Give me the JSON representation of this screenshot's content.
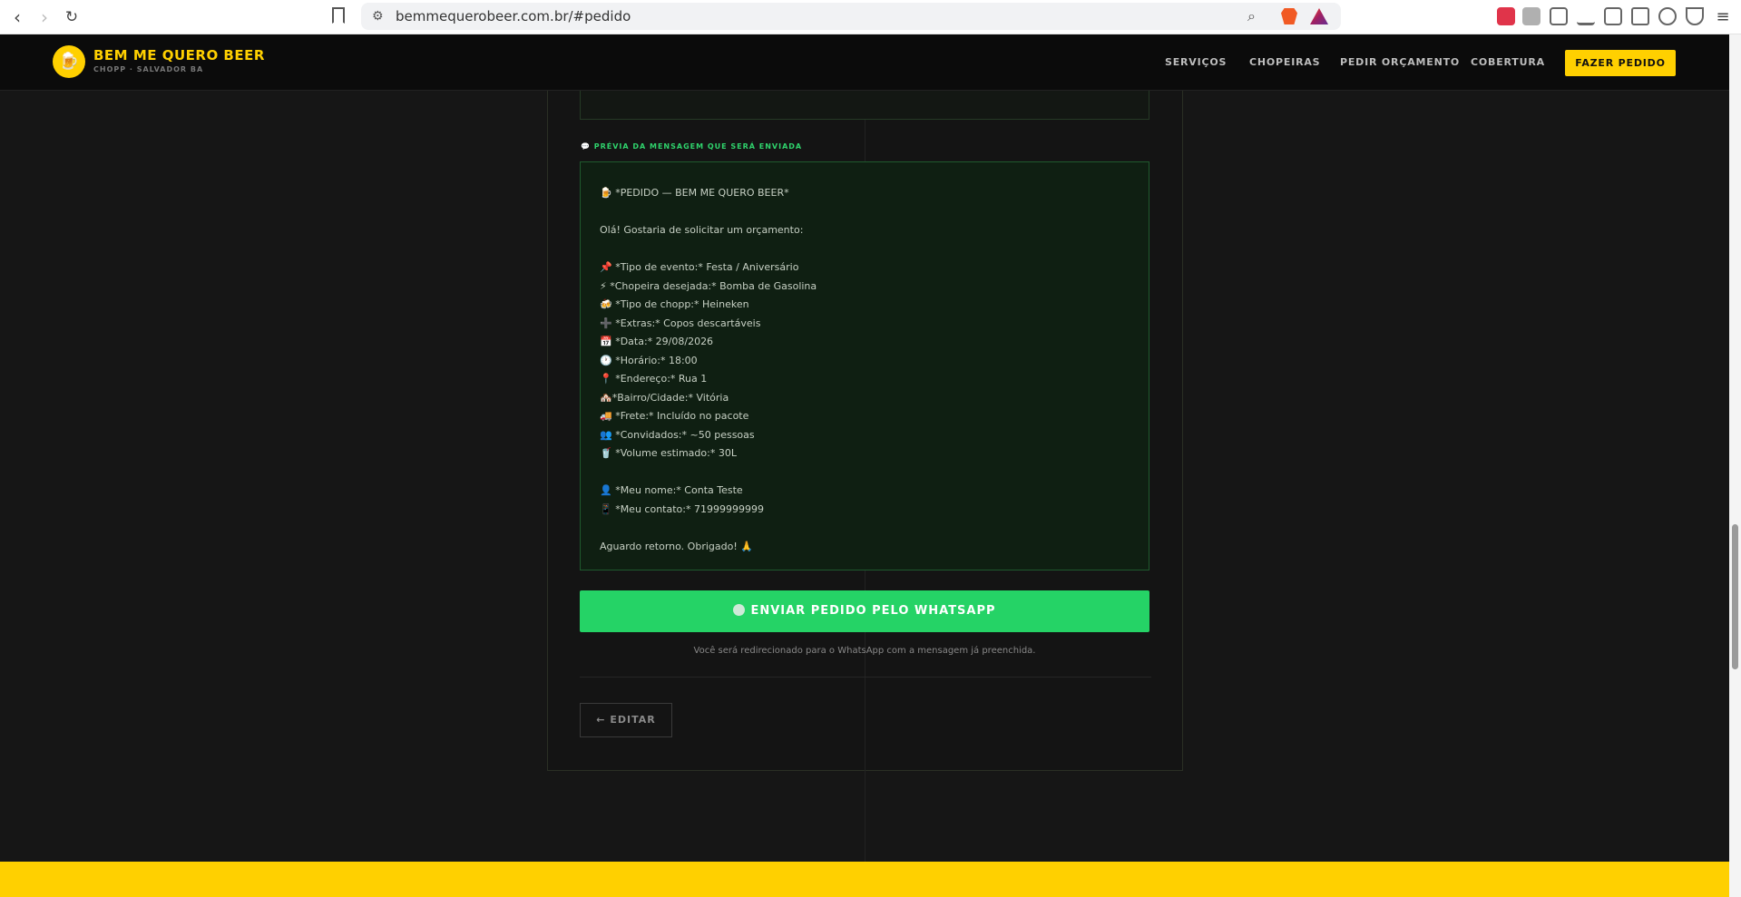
{
  "browser": {
    "url": "bemmequerobeer.com.br/#pedido"
  },
  "header": {
    "brand_name": "BEM ME QUERO BEER",
    "brand_sub": "CHOPP · SALVADOR BA",
    "nav": [
      "SERVIÇOS",
      "CHOPEIRAS",
      "PEDIR ORÇAMENTO",
      "COBERTURA"
    ],
    "cta_label": "FAZER PEDIDO"
  },
  "preview": {
    "label": "💬 PRÉVIA DA MENSAGEM QUE SERÁ ENVIADA",
    "lines": [
      "🍺 *PEDIDO — BEM ME QUERO BEER*",
      "",
      "Olá! Gostaria de solicitar um orçamento:",
      "",
      "📌 *Tipo de evento:* Festa / Aniversário",
      "⚡ *Chopeira desejada:* Bomba de Gasolina",
      "🍻 *Tipo de chopp:* Heineken",
      "➕ *Extras:* Copos descartáveis",
      "📅 *Data:* 29/08/2026",
      "🕐 *Horário:* 18:00",
      "📍 *Endereço:* Rua 1",
      "🏘️*Bairro/Cidade:* Vitória",
      "🚚 *Frete:* Incluído no pacote",
      "👥 *Convidados:* ~50 pessoas",
      "🥤 *Volume estimado:* 30L",
      "",
      "👤 *Meu nome:* Conta Teste",
      "📱 *Meu contato:* 71999999999",
      "",
      "Aguardo retorno. Obrigado! 🙏"
    ]
  },
  "actions": {
    "whatsapp_label": "ENVIAR PEDIDO PELO WHATSAPP",
    "redirect_note": "Você será redirecionado para o WhatsApp com a mensagem já preenchida.",
    "edit_label": "← EDITAR"
  },
  "colors": {
    "brand_yellow": "#ffd000",
    "whatsapp_green": "#25d366"
  }
}
